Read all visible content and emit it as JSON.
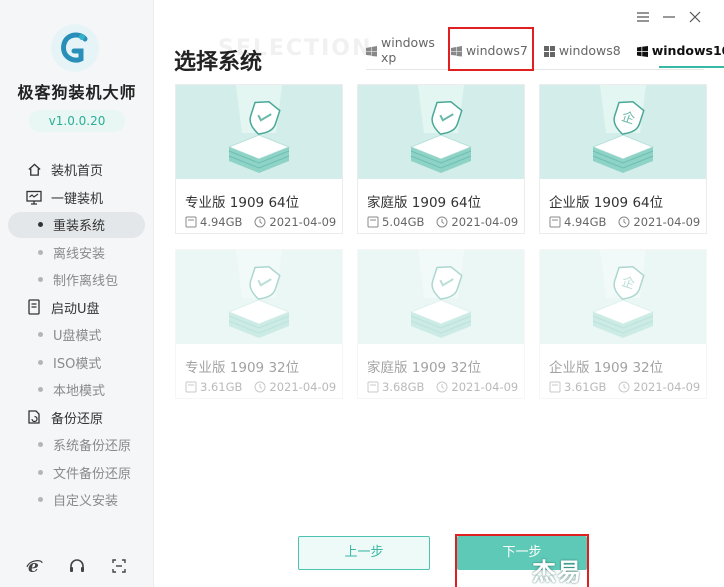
{
  "app": {
    "name": "极客狗装机大师",
    "version": "v1.0.0.20"
  },
  "sidebar": {
    "groups": [
      {
        "label": "装机首页",
        "icon": "home-icon",
        "items": []
      },
      {
        "label": "一键装机",
        "icon": "monitor-icon",
        "items": [
          {
            "label": "重装系统",
            "active": true
          },
          {
            "label": "离线安装",
            "active": false
          },
          {
            "label": "制作离线包",
            "active": false
          }
        ]
      },
      {
        "label": "启动U盘",
        "icon": "usb-icon",
        "items": [
          {
            "label": "U盘模式",
            "active": false
          },
          {
            "label": "ISO模式",
            "active": false
          },
          {
            "label": "本地模式",
            "active": false
          }
        ]
      },
      {
        "label": "备份还原",
        "icon": "backup-icon",
        "items": [
          {
            "label": "系统备份还原",
            "active": false
          },
          {
            "label": "文件备份还原",
            "active": false
          },
          {
            "label": "自定义安装",
            "active": false
          }
        ]
      }
    ],
    "bottom_icons": [
      "ie-browser-icon",
      "headset-icon",
      "expand-icon"
    ]
  },
  "window_controls": [
    "menu-icon",
    "minimize-icon",
    "close-icon"
  ],
  "main": {
    "watermark_title": "SELECTION",
    "title": "选择系统",
    "tabs": [
      {
        "label": "windows xp",
        "icon": "windows-legacy-icon",
        "active": false
      },
      {
        "label": "windows7",
        "icon": "windows-legacy-icon",
        "active": false,
        "highlighted": true
      },
      {
        "label": "windows8",
        "icon": "windows-grid-icon",
        "active": false
      },
      {
        "label": "windows10",
        "icon": "windows10-icon",
        "active": true
      }
    ],
    "cards": [
      {
        "name": "专业版 1909 64位",
        "size": "4.94GB",
        "date": "2021-04-09",
        "emblem": "check",
        "dim": false
      },
      {
        "name": "家庭版 1909 64位",
        "size": "5.04GB",
        "date": "2021-04-09",
        "emblem": "check",
        "dim": false
      },
      {
        "name": "企业版 1909 64位",
        "size": "4.94GB",
        "date": "2021-04-09",
        "emblem": "企",
        "dim": false
      },
      {
        "name": "专业版 1909 32位",
        "size": "3.61GB",
        "date": "2021-04-09",
        "emblem": "check",
        "dim": true
      },
      {
        "name": "家庭版 1909 32位",
        "size": "3.68GB",
        "date": "2021-04-09",
        "emblem": "check",
        "dim": true
      },
      {
        "name": "企业版 1909 32位",
        "size": "3.61GB",
        "date": "2021-04-09",
        "emblem": "企",
        "dim": true
      }
    ],
    "buttons": {
      "prev": "上一步",
      "next": "下一步"
    },
    "corner_watermark": "杰易"
  },
  "colors": {
    "accent": "#37b9a6",
    "button_fill": "#5dc9b6",
    "thumb_bg": "#d6efec",
    "highlight": "#e02020"
  }
}
